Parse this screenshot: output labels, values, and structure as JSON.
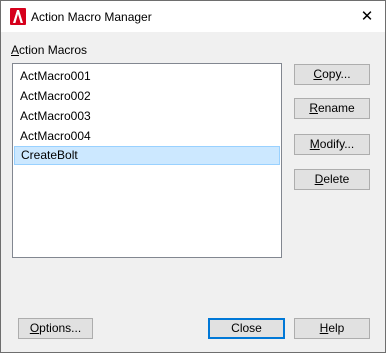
{
  "window": {
    "title": "Action Macro Manager",
    "close_glyph": "✕"
  },
  "group_label": "Action Macros",
  "macros": [
    {
      "label": "ActMacro001",
      "selected": false
    },
    {
      "label": "ActMacro002",
      "selected": false
    },
    {
      "label": "ActMacro003",
      "selected": false
    },
    {
      "label": "ActMacro004",
      "selected": false
    },
    {
      "label": "CreateBolt",
      "selected": true
    }
  ],
  "buttons": {
    "copy": {
      "label": "Copy..."
    },
    "rename": {
      "label": "Rename"
    },
    "modify": {
      "label": "Modify..."
    },
    "delete": {
      "label": "Delete"
    },
    "options": {
      "label": "Options..."
    },
    "close": {
      "label": "Close"
    },
    "help": {
      "label": "Help"
    }
  },
  "colors": {
    "app_icon": "#d6001c",
    "selection_bg": "#cce8ff",
    "default_button_border": "#0078d7"
  }
}
